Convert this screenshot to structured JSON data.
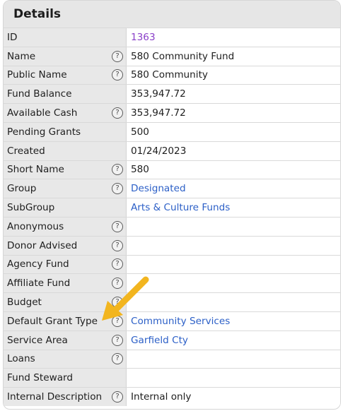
{
  "title": "Details",
  "rows": [
    {
      "label": "ID",
      "value": "1363",
      "help": false,
      "kind": "id"
    },
    {
      "label": "Name",
      "value": "580 Community Fund",
      "help": true,
      "kind": "text"
    },
    {
      "label": "Public Name",
      "value": "580 Community",
      "help": true,
      "kind": "text"
    },
    {
      "label": "Fund Balance",
      "value": "353,947.72",
      "help": false,
      "kind": "text"
    },
    {
      "label": "Available Cash",
      "value": "353,947.72",
      "help": true,
      "kind": "text"
    },
    {
      "label": "Pending Grants",
      "value": "500",
      "help": false,
      "kind": "text"
    },
    {
      "label": "Created",
      "value": "01/24/2023",
      "help": false,
      "kind": "text"
    },
    {
      "label": "Short Name",
      "value": "580",
      "help": true,
      "kind": "text"
    },
    {
      "label": "Group",
      "value": "Designated",
      "help": true,
      "kind": "link"
    },
    {
      "label": "SubGroup",
      "value": "Arts & Culture Funds",
      "help": false,
      "kind": "link"
    },
    {
      "label": "Anonymous",
      "value": "",
      "help": true,
      "kind": "text"
    },
    {
      "label": "Donor Advised",
      "value": "",
      "help": true,
      "kind": "text"
    },
    {
      "label": "Agency Fund",
      "value": "",
      "help": true,
      "kind": "text"
    },
    {
      "label": "Affiliate Fund",
      "value": "",
      "help": true,
      "kind": "text"
    },
    {
      "label": "Budget",
      "value": "",
      "help": true,
      "kind": "text"
    },
    {
      "label": "Default Grant Type",
      "value": "Community Services",
      "help": true,
      "kind": "link"
    },
    {
      "label": "Service Area",
      "value": "Garfield Cty",
      "help": true,
      "kind": "link"
    },
    {
      "label": "Loans",
      "value": "",
      "help": true,
      "kind": "text"
    },
    {
      "label": "Fund Steward",
      "value": "",
      "help": false,
      "kind": "text"
    },
    {
      "label": "Internal Description",
      "value": "Internal only",
      "help": true,
      "kind": "text"
    }
  ],
  "help_glyph": "?",
  "icons": {
    "help": "question-circle-icon",
    "annotation": "arrow-icon"
  },
  "colors": {
    "link": "#2b5fc7",
    "id": "#8a3fc9",
    "arrow": "#f2b51f"
  }
}
